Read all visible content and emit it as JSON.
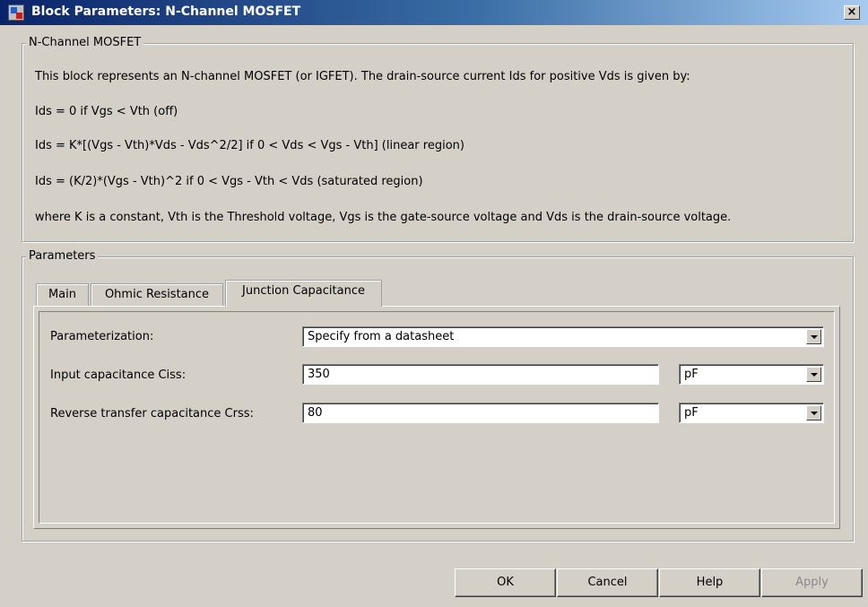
{
  "window": {
    "title": "Block Parameters: N-Channel MOSFET",
    "close_symbol": "×"
  },
  "description": {
    "group_title": "N-Channel MOSFET",
    "lines": [
      "This block represents an N-channel MOSFET (or IGFET). The drain-source current Ids for positive Vds is given by:",
      "Ids = 0 if Vgs < Vth (off)",
      "Ids = K*[(Vgs - Vth)*Vds - Vds^2/2] if 0 < Vds < Vgs - Vth] (linear region)",
      "Ids = (K/2)*(Vgs - Vth)^2 if 0 < Vgs - Vth < Vds (saturated region)",
      "where K is a constant, Vth is the Threshold voltage, Vgs is the gate-source voltage and Vds is the drain-source voltage."
    ]
  },
  "parameters": {
    "group_title": "Parameters",
    "tabs": [
      {
        "label": "Main"
      },
      {
        "label": "Ohmic Resistance"
      },
      {
        "label": "Junction Capacitance"
      }
    ],
    "active_tab": "Junction Capacitance",
    "rows": [
      {
        "label": "Parameterization:",
        "value": "Specify from a datasheet"
      },
      {
        "label": "Input capacitance Ciss:",
        "value": "350",
        "unit": "pF"
      },
      {
        "label": "Reverse transfer capacitance Crss:",
        "value": "80",
        "unit": "pF"
      }
    ]
  },
  "buttons": {
    "ok": "OK",
    "cancel": "Cancel",
    "help": "Help",
    "apply": "Apply"
  },
  "icons": {
    "title": "simulink-block-icon",
    "close": "close-icon",
    "dropdown": "chevron-down-icon"
  }
}
